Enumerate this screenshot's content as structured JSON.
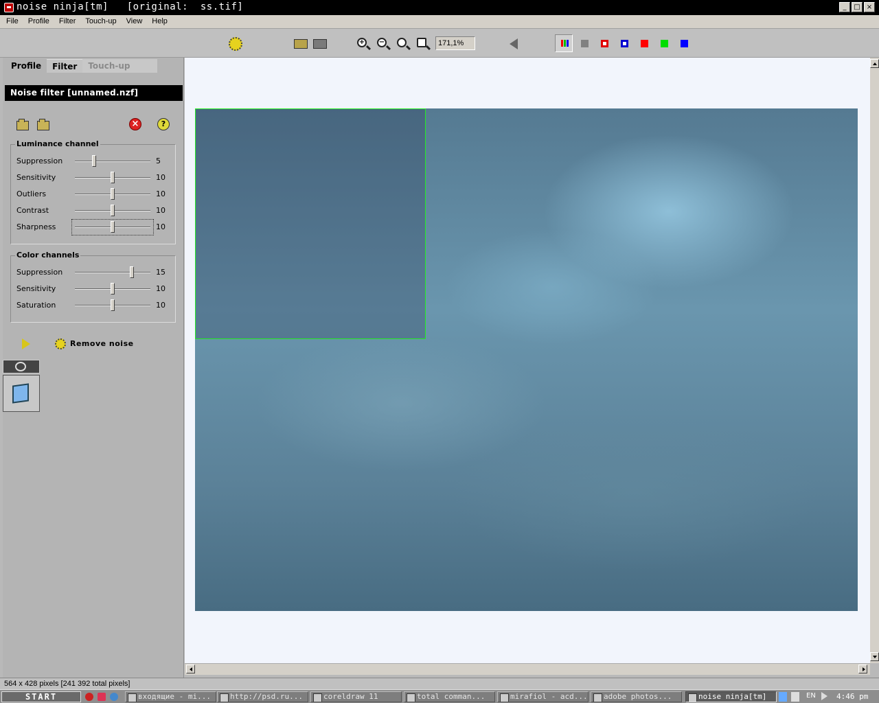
{
  "window": {
    "title": "noise ninja[tm]   [original:  ss.tif]",
    "minimize": "_",
    "maximize": "□",
    "close": "×"
  },
  "menu": [
    "File",
    "Profile",
    "Filter",
    "Touch-up",
    "View",
    "Help"
  ],
  "toolbar": {
    "zoom_value": "171,1%",
    "zoom_in_glyph": "+",
    "zoom_out_glyph": "−",
    "channel_colors": [
      "#808080",
      "#e00000",
      "#0000d0",
      "#ff0000",
      "#00dd00",
      "#0000ff"
    ]
  },
  "panel": {
    "tabs": [
      {
        "label": "Profile",
        "state": "normal"
      },
      {
        "label": "Filter",
        "state": "active"
      },
      {
        "label": "Touch-up",
        "state": "disabled"
      }
    ],
    "title": "Noise filter [unnamed.nzf]",
    "help_glyph": "?",
    "close_glyph": "×",
    "luminance": {
      "legend": "Luminance channel",
      "sliders": [
        {
          "label": "Suppression",
          "value": "5",
          "fraction": 0.25
        },
        {
          "label": "Sensitivity",
          "value": "10",
          "fraction": 0.5
        },
        {
          "label": "Outliers",
          "value": "10",
          "fraction": 0.5
        },
        {
          "label": "Contrast",
          "value": "10",
          "fraction": 0.5
        },
        {
          "label": "Sharpness",
          "value": "10",
          "fraction": 0.5
        }
      ]
    },
    "color": {
      "legend": "Color channels",
      "sliders": [
        {
          "label": "Suppression",
          "value": "15",
          "fraction": 0.75
        },
        {
          "label": "Sensitivity",
          "value": "10",
          "fraction": 0.5
        },
        {
          "label": "Saturation",
          "value": "10",
          "fraction": 0.5
        }
      ]
    },
    "remove_noise_label": "Remove noise"
  },
  "status": {
    "text": "564 x 428 pixels [241 392 total pixels]"
  },
  "taskbar": {
    "start_label": "START",
    "tasks": [
      {
        "label": "входящие - mi...",
        "active": false
      },
      {
        "label": "http://psd.ru...",
        "active": false
      },
      {
        "label": "coreldraw 11",
        "active": false
      },
      {
        "label": "total comman...",
        "active": false
      },
      {
        "label": "mirafiol - acd...",
        "active": false
      },
      {
        "label": "adobe photos...",
        "active": false
      },
      {
        "label": "noise ninja[tm]",
        "active": true
      }
    ],
    "lang": "EN",
    "clock": "4:46 pm"
  }
}
